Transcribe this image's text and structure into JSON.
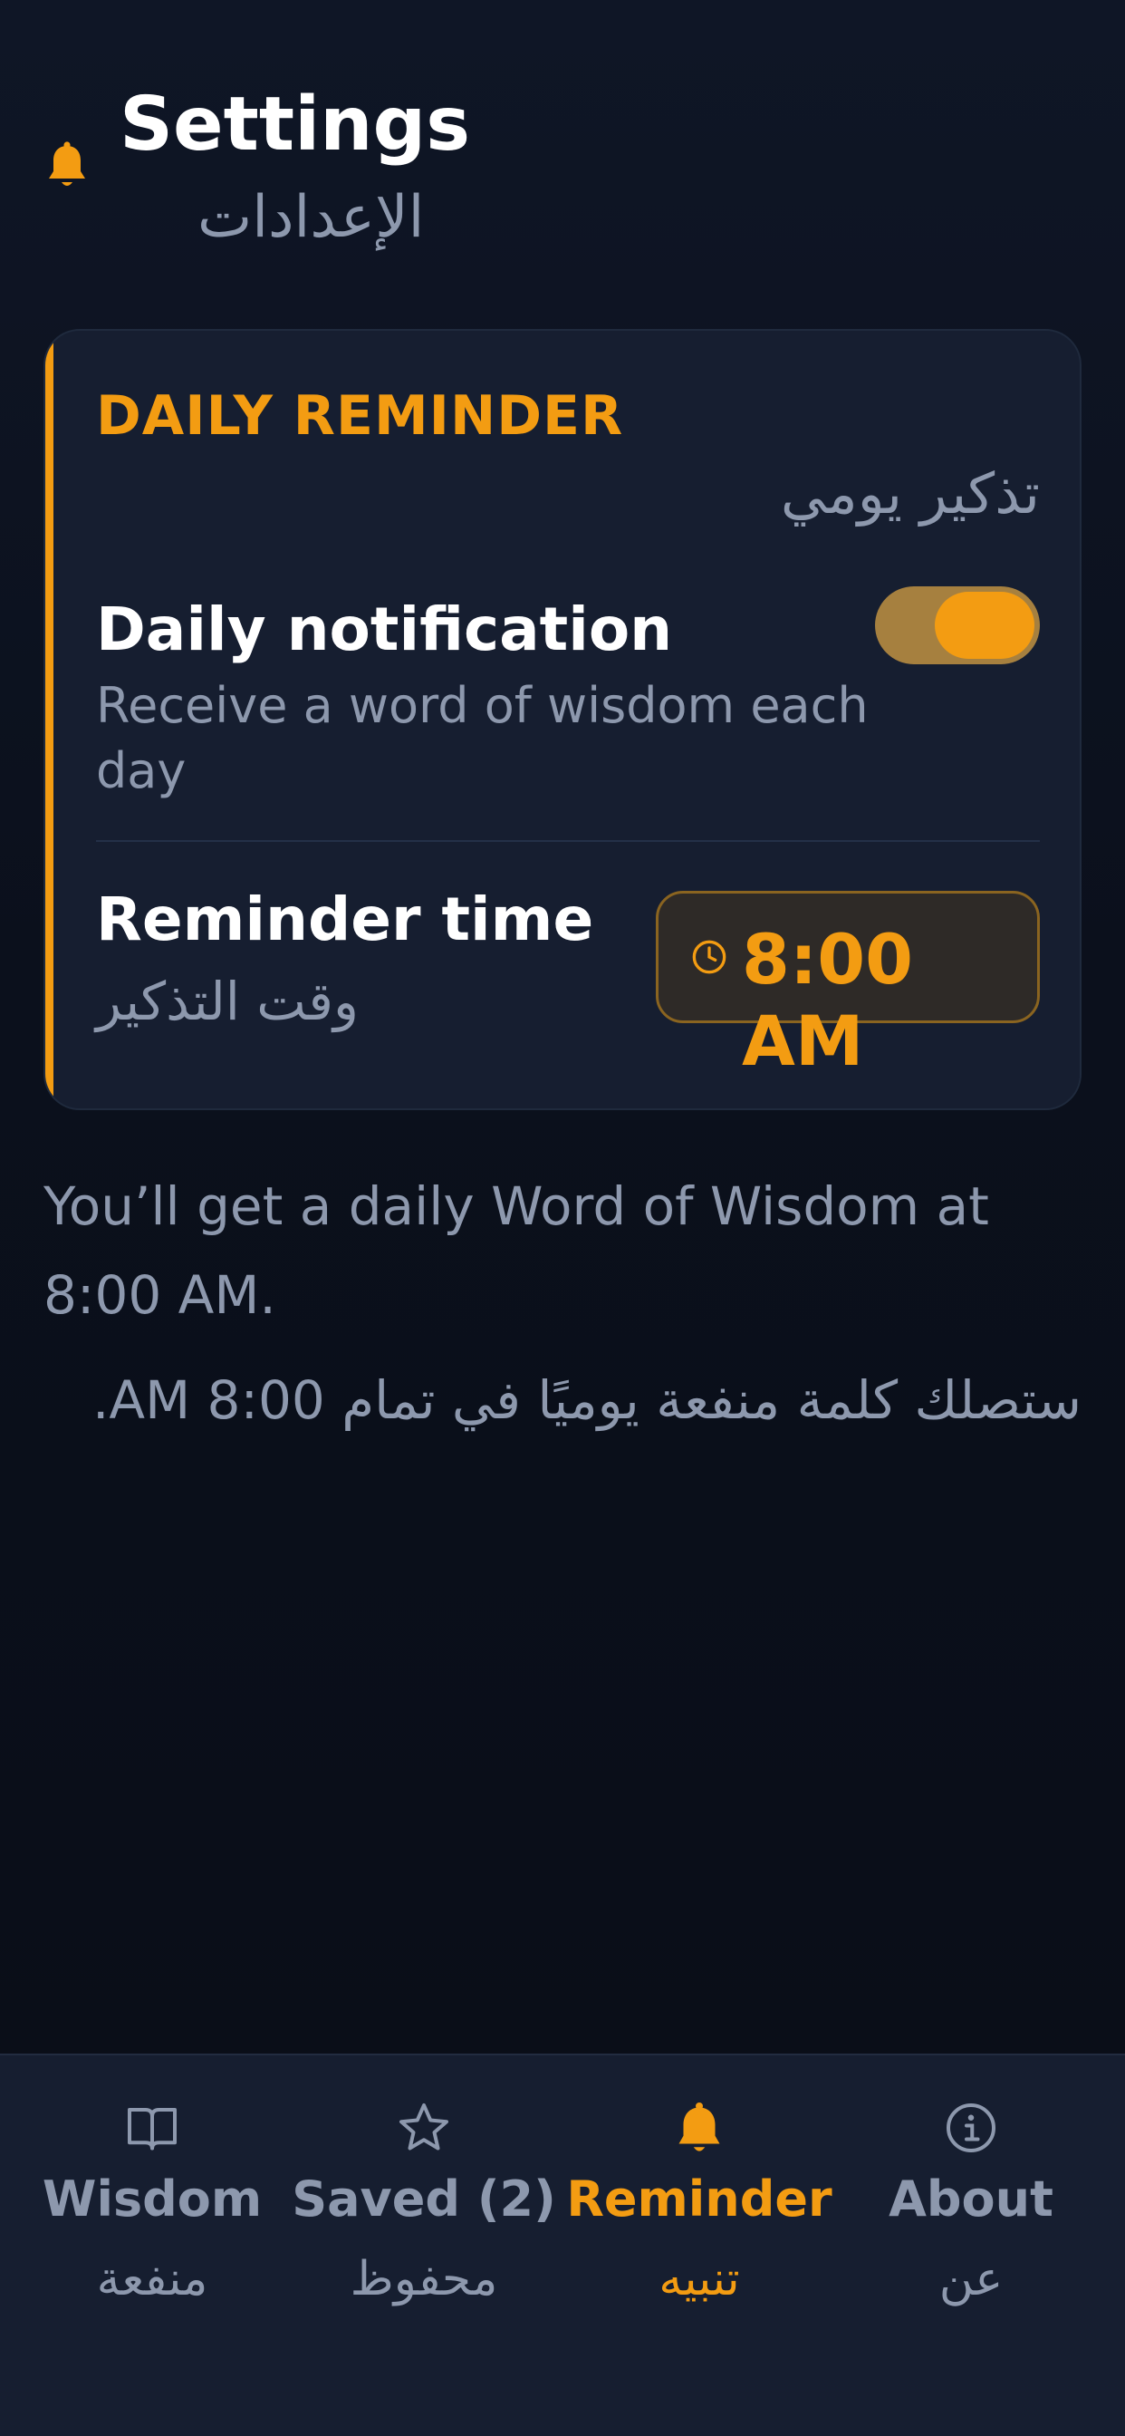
{
  "header": {
    "title": "Settings",
    "title_ar": "الإعدادات",
    "icon": "bell-icon"
  },
  "daily_reminder": {
    "heading": "DAILY REMINDER",
    "heading_ar": "تذكير يومي",
    "notification": {
      "title": "Daily notification",
      "description": "Receive a word of wisdom each day",
      "enabled": true
    },
    "reminder_time": {
      "title": "Reminder time",
      "title_ar": "وقت التذكير",
      "value": "8:00 AM",
      "icon": "clock-icon"
    }
  },
  "info": {
    "text": "You’ll get a daily Word of Wisdom at 8:00 AM.",
    "text_ar": "ستصلك كلمة منفعة يوميًا في تمام 8:00 AM."
  },
  "tabs": [
    {
      "label": "Wisdom",
      "label_ar": "منفعة",
      "icon": "book-icon",
      "active": false
    },
    {
      "label": "Saved (2)",
      "label_ar": "محفوظ",
      "icon": "star-icon",
      "active": false
    },
    {
      "label": "Reminder",
      "label_ar": "تنبيه",
      "icon": "bell-icon",
      "active": true
    },
    {
      "label": "About",
      "label_ar": "عن",
      "icon": "info-icon",
      "active": false
    }
  ],
  "colors": {
    "accent": "#f39c12",
    "background": "#0b101c",
    "card": "#161e30",
    "muted_text": "#8d98ad"
  }
}
